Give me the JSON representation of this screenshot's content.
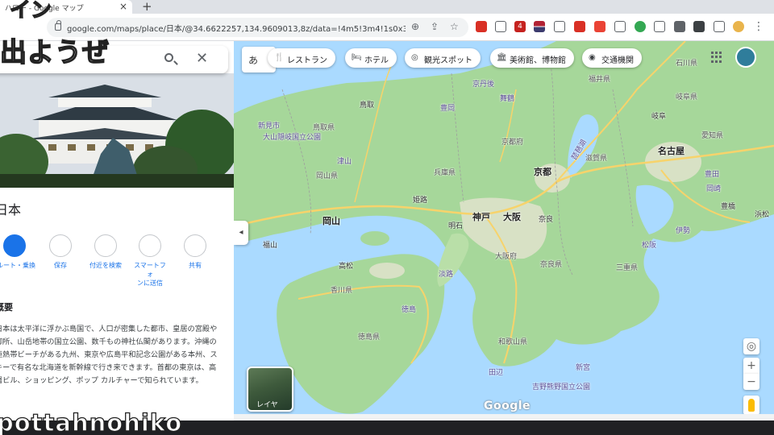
{
  "browser": {
    "tab_title": "ハロー - Google マップ",
    "new_tab_symbol": "+",
    "close_symbol": "×",
    "url": "google.com/maps/place/日本/@34.6622257,134.9609013,8z/data=!4m5!3m4!1s0x34...",
    "extension_badge": "4"
  },
  "overlay": {
    "top_chars": "イン",
    "top_text": "出ようぜ",
    "bottom_text": "pottahnohiko"
  },
  "panel": {
    "title": "日本",
    "close_symbol": "✕",
    "actions": [
      {
        "label": "ルート・乗換"
      },
      {
        "label": "保存"
      },
      {
        "label": "付近を検索"
      },
      {
        "label": "スマートフォ\nンに送信"
      },
      {
        "label": "共有"
      }
    ],
    "section_title": "概要",
    "description": "日本は太平洋に浮かぶ島国で、人口が密集した都市、皇居の宮殿や御所、山岳地帯の国立公園、数千もの神社仏閣があります。沖縄の亜熱帯ビーチがある九州、東京や広島平和記念公園がある本州、スキーで有名な北海道を新幹線で行き来できます。首都の東京は、高層ビル、ショッピング、ポップ カルチャーで知られています。"
  },
  "map": {
    "lang_label": "あ",
    "chips": [
      {
        "label": "レストラン",
        "icon": "fork-knife-icon"
      },
      {
        "label": "ホテル",
        "icon": "bed-icon"
      },
      {
        "label": "観光スポット",
        "icon": "camera-icon"
      },
      {
        "label": "美術館、博物館",
        "icon": "museum-icon"
      },
      {
        "label": "交通機関",
        "icon": "transit-icon"
      }
    ],
    "collapse_symbol": "◂",
    "layer_label": "レイヤ",
    "logo": "Google",
    "zoom_in": "+",
    "zoom_out": "−",
    "cities": [
      "京都",
      "神戸",
      "大阪",
      "岡山",
      "明石",
      "奈良",
      "名古屋",
      "高松",
      "姫路",
      "福山",
      "鳥取",
      "岐阜",
      "浜松",
      "豊橋",
      "四日市"
    ],
    "prefectures": [
      "兵庫県",
      "京都府",
      "滋賀県",
      "大阪府",
      "奈良県",
      "三重県",
      "和歌山県",
      "岡山県",
      "鳥取県",
      "香川県",
      "徳島県",
      "岐阜県",
      "愛知県",
      "福井県",
      "石川県",
      "広島県"
    ],
    "places": [
      "新見市",
      "津山",
      "豊岡",
      "舞鶴",
      "京丹後",
      "姫路",
      "淡路",
      "徳島",
      "伊勢",
      "松阪",
      "田辺",
      "新宮",
      "吉野熊野国立公園",
      "大山隠岐国立公園",
      "豊田",
      "岡崎",
      "琵琶湖",
      "鳴門",
      "福知山",
      "海南",
      "西宮",
      "彦根",
      "大垣",
      "敦賀"
    ],
    "colors": {
      "water": "#aadaff",
      "land": "#a6d79a",
      "land_light": "#c8e6b8",
      "urban": "#e5e3d0",
      "highway": "#f7d36b"
    }
  }
}
